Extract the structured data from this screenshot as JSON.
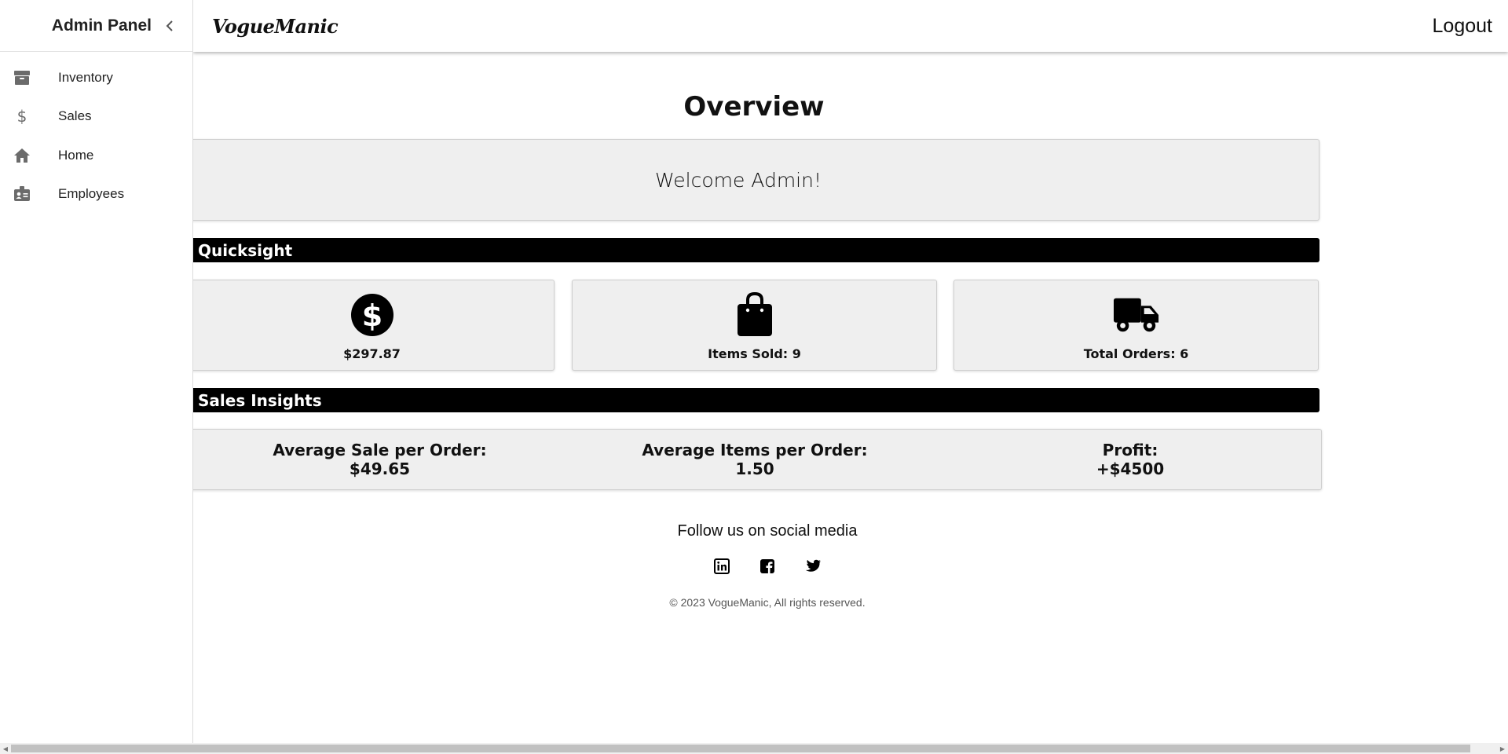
{
  "sidebar": {
    "title": "Admin Panel",
    "items": [
      {
        "label": "Inventory",
        "icon": "archive-icon"
      },
      {
        "label": "Sales",
        "icon": "dollar-icon"
      },
      {
        "label": "Home",
        "icon": "home-icon"
      },
      {
        "label": "Employees",
        "icon": "id-badge-icon"
      }
    ]
  },
  "header": {
    "brand": "VogueManic",
    "logout_label": "Logout"
  },
  "main": {
    "title": "Overview",
    "welcome": "Welcome Admin!",
    "quicksight": {
      "heading": "Quicksight",
      "cards": [
        {
          "icon": "dollar-circle-icon",
          "value": "$297.87"
        },
        {
          "icon": "shopping-bag-icon",
          "value": "Items Sold: 9"
        },
        {
          "icon": "truck-icon",
          "value": "Total Orders: 6"
        }
      ]
    },
    "insights": {
      "heading": "Sales Insights",
      "items": [
        {
          "label": "Average Sale per Order:",
          "value": "$49.65"
        },
        {
          "label": "Average Items per Order:",
          "value": "1.50"
        },
        {
          "label": "Profit:",
          "value": "+$4500"
        }
      ]
    }
  },
  "footer": {
    "follow": "Follow us on social media",
    "socials": [
      "linkedin-icon",
      "facebook-icon",
      "twitter-icon"
    ],
    "copyright": "© 2023 VogueManic, All rights reserved."
  },
  "colors": {
    "bar_bg": "#000000",
    "panel_bg": "#efefef",
    "sidebar_icon": "#6b6b6b"
  }
}
